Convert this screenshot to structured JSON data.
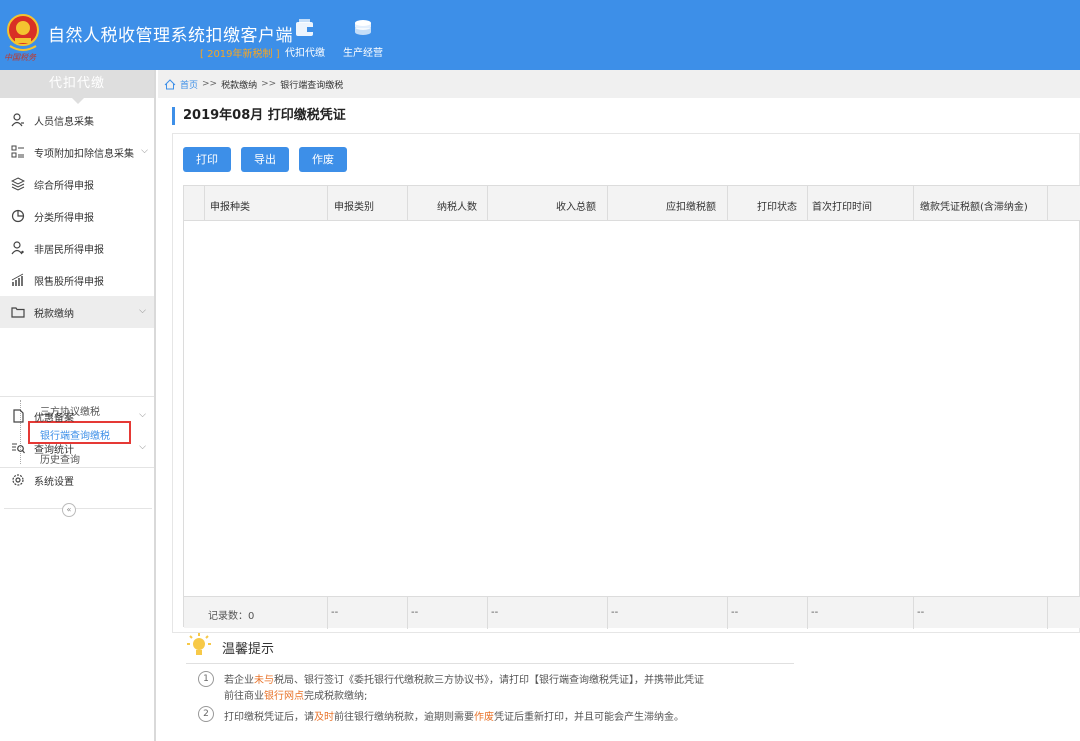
{
  "header": {
    "app_title": "自然人税收管理系统扣缴客户端",
    "app_subtitle": "[ 2019年新税制 ]",
    "emblem_caption": "中国税务",
    "nav": [
      {
        "label": "代扣代缴",
        "icon": "wallet-icon"
      },
      {
        "label": "生产经营",
        "icon": "coins-icon"
      }
    ],
    "bar_color": "#3d8fe8"
  },
  "sidebar": {
    "title": "代扣代缴",
    "items": [
      {
        "label": "人员信息采集",
        "icon": "person-card-icon"
      },
      {
        "label": "专项附加扣除信息采集",
        "icon": "list-grid-icon"
      },
      {
        "label": "综合所得申报",
        "icon": "layers-icon"
      },
      {
        "label": "分类所得申报",
        "icon": "pie-icon"
      },
      {
        "label": "非居民所得申报",
        "icon": "person-icon"
      },
      {
        "label": "限售股所得申报",
        "icon": "bar-chart-icon"
      },
      {
        "label": "税款缴纳",
        "icon": "folder-icon"
      },
      {
        "label": "优惠备案",
        "icon": "document-icon"
      },
      {
        "label": "查询统计",
        "icon": "search-list-icon"
      },
      {
        "label": "系统设置",
        "icon": "gear-icon"
      }
    ],
    "sub_items": [
      "三方协议缴税",
      "银行端查询缴税",
      "历史查询"
    ],
    "collapse_glyph": "«"
  },
  "breadcrumb": {
    "home": "首页",
    "separator": ">>",
    "level1": "税款缴纳",
    "level2": "银行端查询缴税"
  },
  "page_title": "2019年08月  打印缴税凭证",
  "toolbar": {
    "print": "打印",
    "export": "导出",
    "void": "作废"
  },
  "table": {
    "headers": [
      "申报种类",
      "申报类别",
      "纳税人数",
      "收入总额",
      "应扣缴税额",
      "打印状态",
      "首次打印时间",
      "缴款凭证税额(含滞纳金)"
    ],
    "footer": [
      "记录数：0",
      "--",
      "--",
      "--",
      "--",
      "--",
      "--",
      "--"
    ]
  },
  "tips": {
    "title": "温馨提示",
    "tip1": {
      "num": "1",
      "a": "若企业",
      "b": "未与",
      "c": "税局、银行签订《委托银行代缴税款三方协议书》，请打印【银行端查询缴税凭证】，并携带此凭证",
      "d": "前往商业",
      "e": "银行网点",
      "f": "完成税款缴纳;"
    },
    "tip2": {
      "num": "2",
      "a": "打印缴税凭证后，请",
      "b": "及时",
      "c": "前往银行缴纳税款，逾期则需要",
      "d": "作废",
      "e": "凭证后重新打印，并且可能会产生滞纳金。"
    }
  }
}
